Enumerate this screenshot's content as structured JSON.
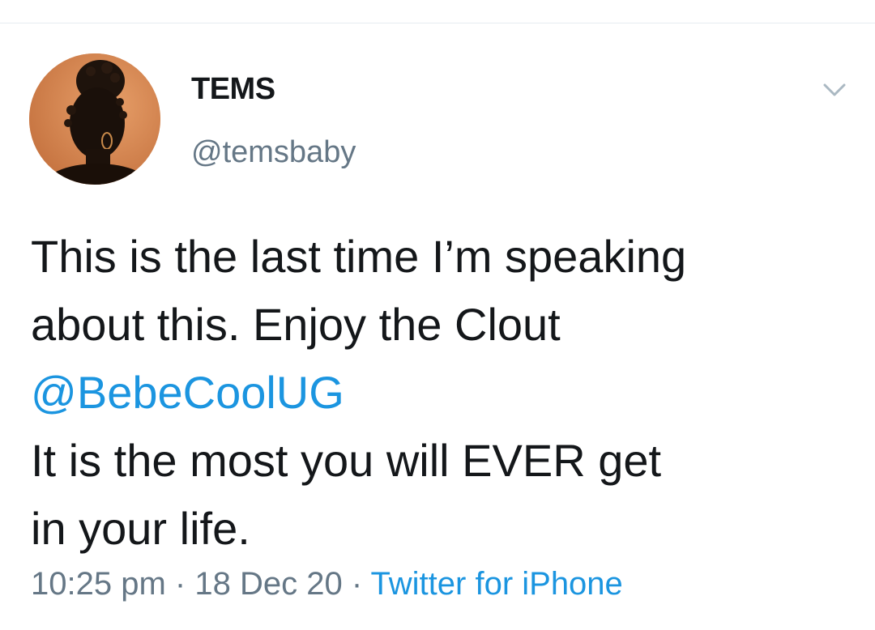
{
  "tweet": {
    "display_name": "TEMS",
    "handle": "@temsbaby",
    "text_lines": [
      "This is the last time I’m speaking",
      "about this. Enjoy the Clout",
      "@BebeCoolUG",
      "It is the most you will EVER get",
      "in your life."
    ],
    "mention": "@BebeCoolUG",
    "time": "10:25 pm",
    "date": "18 Dec 20",
    "separator": "·",
    "source": "Twitter for iPhone"
  },
  "icons": {
    "menu": "chevron-down-icon",
    "avatar": "profile-photo"
  },
  "colors": {
    "link": "#1b95e0",
    "secondary_text": "#657786",
    "primary_text": "#14171a",
    "divider": "#e6ecf0"
  }
}
